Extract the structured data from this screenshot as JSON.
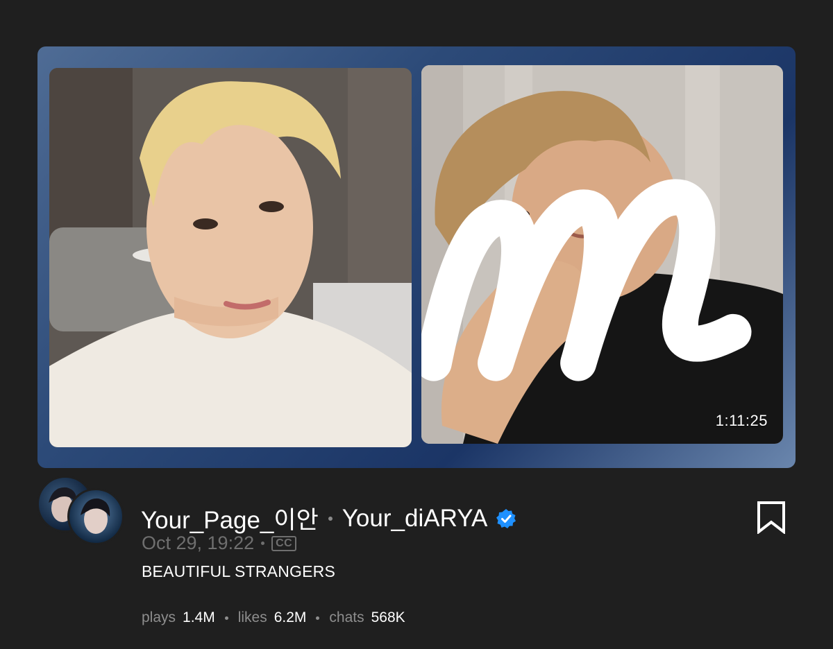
{
  "player": {
    "duration": "1:11:25",
    "brand_logo": "m-script-logo-icon"
  },
  "post": {
    "channel_primary": "Your_Page_이안",
    "channel_secondary": "Your_diARYA",
    "verified_icon": "verified-check-icon",
    "date": "Oct 29, 19:22",
    "cc_label": "CC",
    "title": "BEAUTIFUL STRANGERS"
  },
  "stats": {
    "plays_label": "plays",
    "plays_value": "1.4M",
    "likes_label": "likes",
    "likes_value": "6.2M",
    "chats_label": "chats",
    "chats_value": "568K"
  },
  "actions": {
    "bookmark_icon": "bookmark-icon"
  },
  "colors": {
    "background": "#1f1f1f",
    "card_frame": "#2c4a78",
    "verified": "#1e90ff",
    "muted_text": "#6f6f6f"
  }
}
